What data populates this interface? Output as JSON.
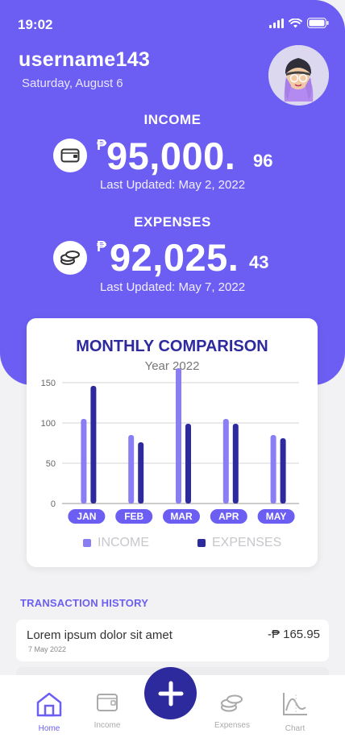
{
  "status": {
    "time": "19:02"
  },
  "user": {
    "name": "username143",
    "date": "Saturday, August 6"
  },
  "income": {
    "title": "INCOME",
    "currency": "₱",
    "whole": "95,000.",
    "cents": "96",
    "updated": "Last Updated: May 2, 2022"
  },
  "expenses": {
    "title": "EXPENSES",
    "currency": "₱",
    "whole": "92,025.",
    "cents": "43",
    "updated": "Last Updated: May 7, 2022"
  },
  "chart": {
    "title": "MONTHLY COMPARISON",
    "subtitle": "Year 2022"
  },
  "chart_data": {
    "type": "bar",
    "title": "MONTHLY COMPARISON",
    "subtitle": "Year 2022",
    "categories": [
      "JAN",
      "FEB",
      "MAR",
      "APR",
      "MAY"
    ],
    "series": [
      {
        "name": "INCOME",
        "values": [
          105,
          85,
          168,
          105,
          85
        ]
      },
      {
        "name": "EXPENSES",
        "values": [
          146,
          76,
          99,
          99,
          81
        ]
      }
    ],
    "yticks": [
      0,
      50,
      100,
      150
    ],
    "ylim": [
      0,
      170
    ],
    "grid": true,
    "legend": "bottom",
    "colors": {
      "INCOME": "#8a7ef5",
      "EXPENSES": "#2d2a9e"
    }
  },
  "transactions": {
    "header": "TRANSACTION HISTORY",
    "items": [
      {
        "title": "Lorem ipsum dolor sit amet",
        "date": "7 May 2022",
        "amount": "-₱ 165.95"
      }
    ]
  },
  "nav": {
    "home": "Home",
    "income": "Income",
    "expenses": "Expenses",
    "chart": "Chart"
  },
  "icons": {
    "wallet": "wallet-icon",
    "coins": "coins-icon",
    "home": "home-icon",
    "add": "plus-icon",
    "chart": "chart-icon"
  },
  "colors": {
    "primary": "#6c5ef2",
    "dark": "#2d2a9e"
  }
}
